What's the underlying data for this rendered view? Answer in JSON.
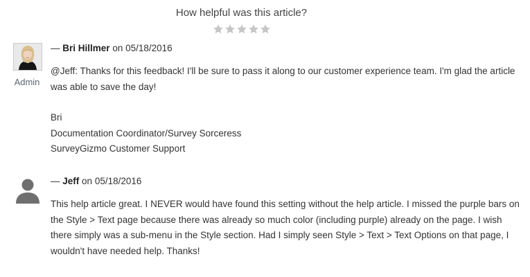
{
  "rating": {
    "title": "How helpful was this article?",
    "stars_total": 5,
    "stars_filled": 0,
    "star_color": "#c6c6c6"
  },
  "comments": [
    {
      "dash": "—",
      "author": "Bri Hillmer",
      "on": "on",
      "date": "05/18/2016",
      "role": "Admin",
      "avatar": "profile-photo",
      "body": "@Jeff: Thanks for this feedback! I'll be sure to pass it along to our customer experience team. I'm glad the article was able to save the day!",
      "signature": [
        "Bri",
        "Documentation Coordinator/Survey Sorceress",
        "SurveyGizmo Customer Support"
      ]
    },
    {
      "dash": "—",
      "author": "Jeff",
      "on": "on",
      "date": "05/18/2016",
      "avatar": "generic-user-icon",
      "body": "This help article great. I NEVER would have found this setting without the help article. I missed the purple bars on the Style > Text page because there was already so much color (including purple) already on the page. I wish there simply was a sub-menu in the Style section. Had I simply seen Style > Text > Text Options on that page, I wouldn't have needed help. Thanks!"
    }
  ]
}
